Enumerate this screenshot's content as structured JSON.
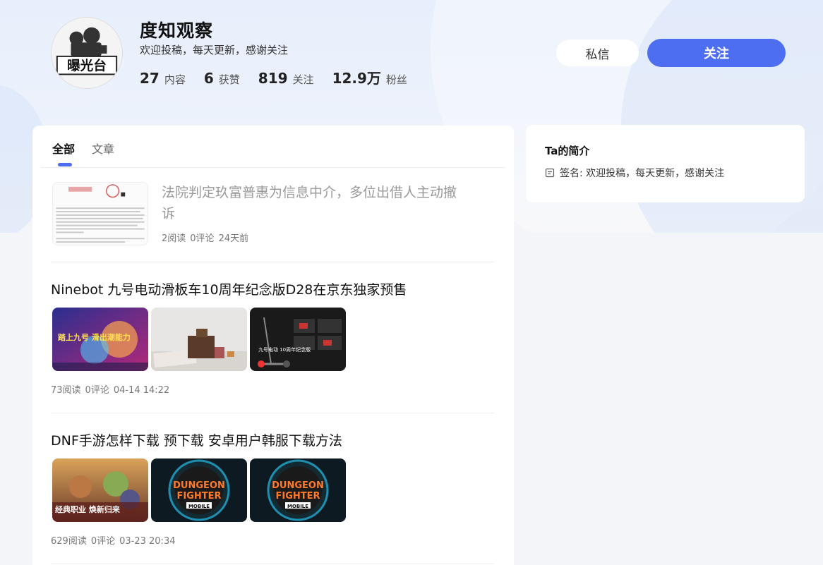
{
  "profile": {
    "name": "度知观察",
    "signature": "欢迎投稿，每天更新，感谢关注",
    "avatar_text": "曝光台",
    "stats": [
      {
        "num": "27",
        "label": "内容"
      },
      {
        "num": "6",
        "label": "获赞"
      },
      {
        "num": "819",
        "label": "关注"
      },
      {
        "num": "12.9万",
        "label": "粉丝"
      }
    ]
  },
  "actions": {
    "message_label": "私信",
    "follow_label": "关注"
  },
  "tabs": [
    {
      "label": "全部",
      "active": true
    },
    {
      "label": "文章",
      "active": false
    }
  ],
  "articles": [
    {
      "title": "法院判定玖富普惠为信息中介，多位出借人主动撤诉",
      "reads": "2阅读",
      "comments": "0评论",
      "time": "24天前"
    },
    {
      "title": "Ninebot 九号电动滑板车10周年纪念版D28在京东独家预售",
      "reads": "73阅读",
      "comments": "0评论",
      "time": "04-14 14:22",
      "image_text": [
        "踏上九号 滑出潮能力",
        "九号电动 10周年纪念版"
      ]
    },
    {
      "title": "DNF手游怎样下载 预下载 安卓用户韩服下载方法",
      "reads": "629阅读",
      "comments": "0评论",
      "time": "03-23 20:34",
      "image_text": [
        "经典职业 焕新归来",
        "DUNGEON",
        "FIGHTER",
        "MOBILE"
      ]
    }
  ],
  "sidebar": {
    "title": "Ta的简介",
    "signature": "签名: 欢迎投稿，每天更新，感谢关注"
  },
  "colors": {
    "accent": "#4e6ef2",
    "bg": "#f4f5f8"
  }
}
